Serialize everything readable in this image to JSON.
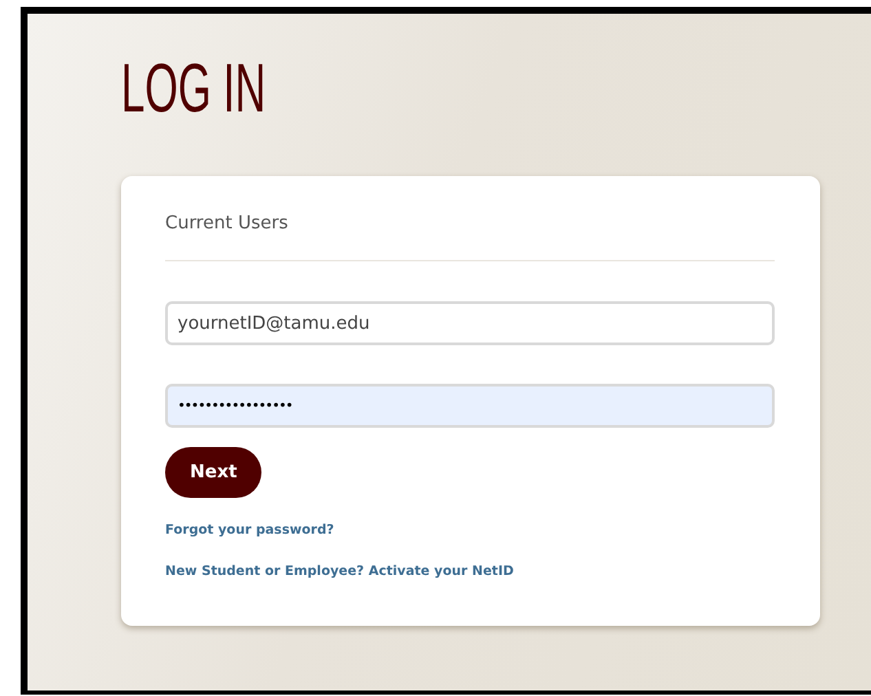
{
  "heading": "LOG IN",
  "card": {
    "section_title": "Current Users",
    "fields": [
      {
        "kind": "text",
        "value": "yournetID@tamu.edu",
        "autofilled": false
      },
      {
        "kind": "password",
        "value": "•••••••••••••••••",
        "autofilled": true
      }
    ],
    "button": "Next",
    "links": [
      "Forgot your password?",
      "New Student or Employee? Activate your NetID"
    ]
  }
}
